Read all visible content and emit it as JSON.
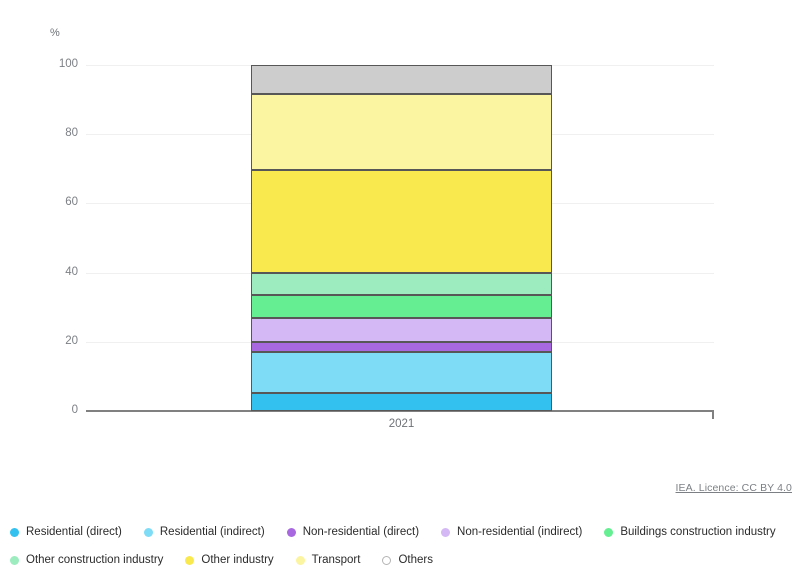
{
  "chart_data": {
    "type": "bar",
    "subtype": "stacked-percentage-column",
    "title": "",
    "xlabel": "",
    "ylabel": "%",
    "ylim": [
      0,
      100
    ],
    "yticks": [
      0,
      20,
      40,
      60,
      80,
      100
    ],
    "grid": true,
    "legend_position": "bottom",
    "categories": [
      "2021"
    ],
    "series": [
      {
        "name": "Residential (direct)",
        "color": "#33c1f0",
        "values": [
          5.2
        ],
        "cumulative_top": 5.2
      },
      {
        "name": "Residential (indirect)",
        "color": "#7fdcf7",
        "values": [
          11.8
        ],
        "cumulative_top": 17.0
      },
      {
        "name": "Non-residential (direct)",
        "color": "#a869e0",
        "values": [
          2.8
        ],
        "cumulative_top": 19.8
      },
      {
        "name": "Non-residential (indirect)",
        "color": "#d3b8f5",
        "values": [
          7.2
        ],
        "cumulative_top": 27.0
      },
      {
        "name": "Buildings construction industry",
        "color": "#66ef92",
        "values": [
          6.5
        ],
        "cumulative_top": 33.5
      },
      {
        "name": "Other construction industry",
        "color": "#9cecc0",
        "values": [
          6.5
        ],
        "cumulative_top": 40.0
      },
      {
        "name": "Other industry",
        "color": "#fae94e",
        "values": [
          29.7
        ],
        "cumulative_top": 69.7
      },
      {
        "name": "Transport",
        "color": "#fbf4a0",
        "values": [
          21.8
        ],
        "cumulative_top": 91.5
      },
      {
        "name": "Others",
        "color": "#cdcdcd",
        "values": [
          8.5
        ],
        "cumulative_top": 100.0
      }
    ]
  },
  "axis": {
    "unit_label": "%",
    "ytick_labels": [
      "0",
      "20",
      "40",
      "60",
      "80",
      "100"
    ],
    "xtick_labels": [
      "2021"
    ]
  },
  "legend": {
    "items": [
      {
        "label": "Residential (direct)",
        "color": "#33c1f0",
        "style": "filled"
      },
      {
        "label": "Residential (indirect)",
        "color": "#7fdcf7",
        "style": "filled"
      },
      {
        "label": "Non-residential (direct)",
        "color": "#a869e0",
        "style": "filled"
      },
      {
        "label": "Non-residential (indirect)",
        "color": "#d3b8f5",
        "style": "filled"
      },
      {
        "label": "Buildings construction industry",
        "color": "#66ef92",
        "style": "filled"
      },
      {
        "label": "Other construction industry",
        "color": "#9cecc0",
        "style": "filled"
      },
      {
        "label": "Other industry",
        "color": "#fae94e",
        "style": "filled"
      },
      {
        "label": "Transport",
        "color": "#fbf4a0",
        "style": "filled"
      },
      {
        "label": "Others",
        "color": "#cdcdcd",
        "style": "outlined"
      }
    ]
  },
  "credit": {
    "text": "IEA. Licence: CC BY 4.0"
  }
}
